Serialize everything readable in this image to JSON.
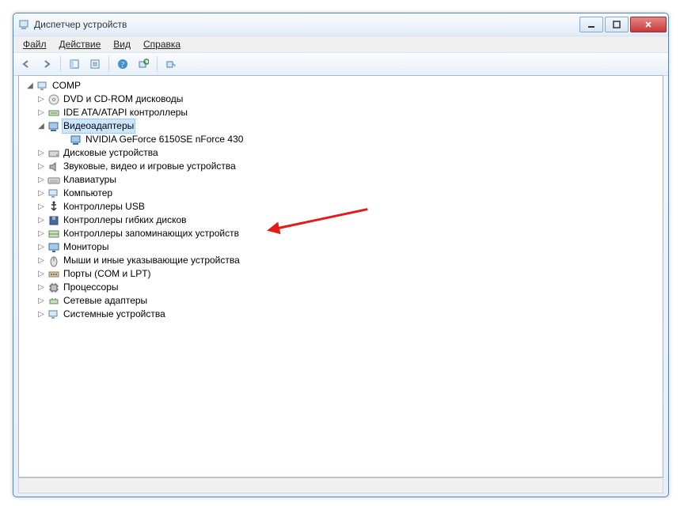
{
  "window": {
    "title": "Диспетчер устройств"
  },
  "menu": {
    "file": "Файл",
    "action": "Действие",
    "view": "Вид",
    "help": "Справка"
  },
  "tree": {
    "root": "COMP",
    "items": [
      {
        "label": "DVD и CD-ROM дисководы"
      },
      {
        "label": "IDE ATA/ATAPI контроллеры"
      },
      {
        "label": "Видеоадаптеры",
        "expanded": true,
        "selected": true,
        "children": [
          {
            "label": "NVIDIA GeForce 6150SE nForce 430"
          }
        ]
      },
      {
        "label": "Дисковые устройства"
      },
      {
        "label": "Звуковые, видео и игровые устройства"
      },
      {
        "label": "Клавиатуры"
      },
      {
        "label": "Компьютер"
      },
      {
        "label": "Контроллеры USB"
      },
      {
        "label": "Контроллеры гибких дисков"
      },
      {
        "label": "Контроллеры запоминающих устройств"
      },
      {
        "label": "Мониторы"
      },
      {
        "label": "Мыши и иные указывающие устройства"
      },
      {
        "label": "Порты (COM и LPT)"
      },
      {
        "label": "Процессоры"
      },
      {
        "label": "Сетевые адаптеры"
      },
      {
        "label": "Системные устройства"
      }
    ]
  }
}
